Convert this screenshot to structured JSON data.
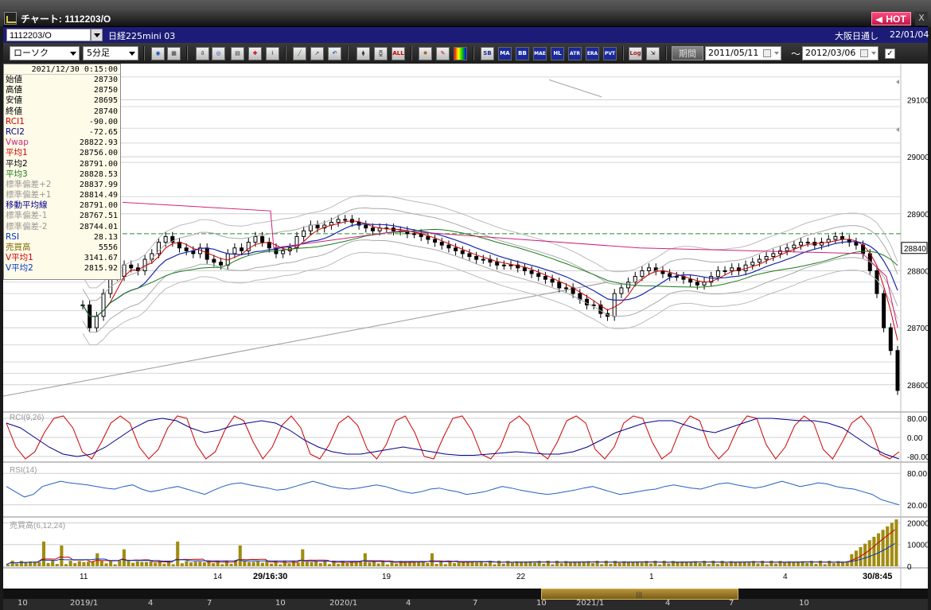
{
  "window": {
    "title": "チャート: 1112203/O",
    "hot_label": "HOT",
    "close_label": "X"
  },
  "infobar": {
    "symbol": "1112203/O",
    "market": "日経225mini 03",
    "session": "大阪日通し",
    "date": "22/01/04"
  },
  "toolbar": {
    "chart_type": "ローソク",
    "interval": "5分足",
    "buttons": [
      "zoom",
      "window",
      "compare",
      "screener",
      "news",
      "info",
      "draw",
      "pointer",
      "undo",
      "candle-wide",
      "candle-narrow",
      "all",
      "settings",
      "tools",
      "palette",
      "SB",
      "MA",
      "BB",
      "MAE",
      "HL",
      "ATR",
      "ERA",
      "PVT",
      "Log",
      "export"
    ],
    "all_label": "ALL",
    "sb_label": "SB",
    "ma_label": "MA",
    "bb_label": "BB",
    "mae_label": "MAE",
    "hl_label": "HL",
    "atr_label": "ATR",
    "era_label": "ERA",
    "pvt_label": "PVT",
    "log_label": "Log",
    "period_label": "期間",
    "date_from": "2011/05/11",
    "date_to": "2012/03/06",
    "tilde": "〜",
    "check": "✓"
  },
  "datawindow": {
    "timestamp": "2021/12/30 0:15:00",
    "rows": [
      {
        "label": "始値",
        "value": "28730",
        "color": "#000000"
      },
      {
        "label": "高値",
        "value": "28750",
        "color": "#000000"
      },
      {
        "label": "安値",
        "value": "28695",
        "color": "#000000"
      },
      {
        "label": "終値",
        "value": "28740",
        "color": "#000000"
      },
      {
        "label": "RCI1",
        "value": "-90.00",
        "color": "#cc0000"
      },
      {
        "label": "RCI2",
        "value": "-72.65",
        "color": "#00008b"
      },
      {
        "label": "Vwap",
        "value": "28822.93",
        "color": "#d0207a"
      },
      {
        "label": "平均1",
        "value": "28756.00",
        "color": "#cc0000"
      },
      {
        "label": "平均2",
        "value": "28791.00",
        "color": "#000000"
      },
      {
        "label": "平均3",
        "value": "28828.53",
        "color": "#1a7a1a"
      },
      {
        "label": "標準偏差+2",
        "value": "28837.99",
        "color": "#9a9a9a"
      },
      {
        "label": "標準偏差+1",
        "value": "28814.49",
        "color": "#9a9a9a"
      },
      {
        "label": "移動平均線",
        "value": "28791.00",
        "color": "#00008b"
      },
      {
        "label": "標準偏差-1",
        "value": "28767.51",
        "color": "#9a9a9a"
      },
      {
        "label": "標準偏差-2",
        "value": "28744.01",
        "color": "#9a9a9a"
      },
      {
        "label": "RSI",
        "value": "28.13",
        "color": "#0033cc"
      },
      {
        "label": "売買高",
        "value": "5556",
        "color": "#7a6a00"
      },
      {
        "label": "V平均1",
        "value": "3141.67",
        "color": "#cc0000"
      },
      {
        "label": "V平均2",
        "value": "2815.92",
        "color": "#0033cc"
      }
    ]
  },
  "chart_data": {
    "type": "line",
    "price": {
      "yticks": [
        28600,
        28700,
        28800,
        28900,
        29000,
        29100
      ],
      "ylim": [
        28555,
        29155
      ],
      "current_price_label": "28840",
      "reference_line": 28865,
      "candles": {
        "label_note": "5-min candles, approx closes",
        "closes": [
          28740,
          28700,
          28720,
          28760,
          28800,
          28790,
          28810,
          28805,
          28800,
          28820,
          28830,
          28850,
          28860,
          28850,
          28840,
          28835,
          28830,
          28840,
          28820,
          28815,
          28810,
          28830,
          28840,
          28835,
          28850,
          28860,
          28850,
          28840,
          28830,
          28835,
          28840,
          28860,
          28870,
          28880,
          28875,
          28880,
          28885,
          28890,
          28890,
          28885,
          28880,
          28875,
          28870,
          28875,
          28875,
          28870,
          28870,
          28865,
          28865,
          28860,
          28855,
          28850,
          28845,
          28840,
          28835,
          28830,
          28825,
          28820,
          28820,
          28815,
          28810,
          28810,
          28810,
          28805,
          28800,
          28795,
          28790,
          28785,
          28780,
          28770,
          28770,
          28760,
          28750,
          28740,
          28740,
          28725,
          28720,
          28760,
          28770,
          28780,
          28790,
          28800,
          28805,
          28800,
          28795,
          28790,
          28790,
          28785,
          28780,
          28775,
          28780,
          28790,
          28800,
          28800,
          28805,
          28800,
          28810,
          28815,
          28820,
          28825,
          28830,
          28835,
          28840,
          28845,
          28850,
          28850,
          28845,
          28850,
          28855,
          28860,
          28855,
          28850,
          28845,
          28830,
          28800,
          28760,
          28700,
          28660,
          28590
        ]
      }
    },
    "rci": {
      "title": "RCI(9,26)",
      "yticks": [
        80,
        0,
        -80
      ],
      "ylim": [
        -100,
        100
      ],
      "rci1_color": "#cc0000",
      "rci2_color": "#00008b",
      "rci1": [
        60,
        -40,
        -90,
        -60,
        20,
        80,
        90,
        40,
        -60,
        -90,
        -20,
        60,
        90,
        60,
        -40,
        -90,
        -50,
        40,
        90,
        80,
        -30,
        -90,
        -60,
        30,
        90,
        70,
        -20,
        -90,
        -40,
        50,
        90,
        40,
        -70,
        -90,
        -30,
        60,
        90,
        50,
        -50,
        -90,
        -30,
        70,
        90,
        20,
        -80,
        -90,
        0,
        80,
        90,
        30,
        -70,
        -90,
        -40,
        60,
        90,
        50,
        -60,
        -90,
        -20,
        70,
        90,
        60,
        -50,
        -90,
        -40,
        60,
        90,
        80,
        -20,
        -90,
        -60,
        40,
        90,
        70,
        -40,
        -90,
        -50,
        40,
        90,
        80,
        -30,
        -90,
        -40,
        50,
        90,
        60,
        -50,
        -90,
        -20,
        60,
        90,
        40,
        -70,
        -90,
        -60
      ],
      "rci2": [
        60,
        40,
        0,
        -40,
        -70,
        -80,
        -70,
        -40,
        0,
        40,
        70,
        80,
        70,
        40,
        20,
        30,
        50,
        60,
        70,
        60,
        30,
        -10,
        -40,
        -60,
        -70,
        -70,
        -60,
        -50,
        -40,
        -50,
        -60,
        -70,
        -75,
        -75,
        -70,
        -65,
        -60,
        -65,
        -70,
        -70,
        -60,
        -40,
        -10,
        20,
        40,
        60,
        70,
        70,
        50,
        30,
        20,
        40,
        60,
        80,
        80,
        75,
        70,
        70,
        60,
        40,
        0,
        -40,
        -70,
        -90
      ]
    },
    "rsi": {
      "title": "RSI(14)",
      "yticks": [
        80,
        20
      ],
      "ylim": [
        0,
        100
      ],
      "color": "#2060c0",
      "values": [
        55,
        45,
        35,
        40,
        55,
        60,
        65,
        62,
        60,
        58,
        55,
        52,
        50,
        55,
        58,
        50,
        45,
        48,
        52,
        55,
        50,
        45,
        40,
        48,
        55,
        60,
        62,
        58,
        55,
        52,
        48,
        50,
        55,
        60,
        65,
        60,
        55,
        52,
        50,
        52,
        55,
        58,
        55,
        50,
        45,
        42,
        45,
        50,
        52,
        48,
        45,
        40,
        42,
        45,
        50,
        55,
        52,
        48,
        45,
        42,
        40,
        42,
        45,
        48,
        52,
        55,
        50,
        45,
        40,
        42,
        45,
        48,
        50,
        55,
        58,
        55,
        52,
        50,
        55,
        60,
        62,
        58,
        55,
        52,
        55,
        60,
        65,
        60,
        55,
        58,
        62,
        60,
        55,
        52,
        50,
        45,
        40,
        30,
        25,
        20
      ]
    },
    "volume": {
      "title": "売買高(6,12,24)",
      "yticks": [
        20000,
        10000,
        0
      ],
      "ylim": [
        0,
        22000
      ],
      "bar_color": "#a08c10",
      "ma_colors": [
        "#cc0000",
        "#0033cc",
        "#1a7a1a"
      ]
    },
    "x_labels": [
      "11",
      "14",
      "29/16:30",
      "19",
      "22",
      "1",
      "4",
      "30/8:45"
    ],
    "navigator_labels": [
      "10",
      "2019/1",
      "4",
      "7",
      "10",
      "2020/1",
      "4",
      "7",
      "10",
      "2021/1",
      "4",
      "7",
      "10"
    ]
  }
}
